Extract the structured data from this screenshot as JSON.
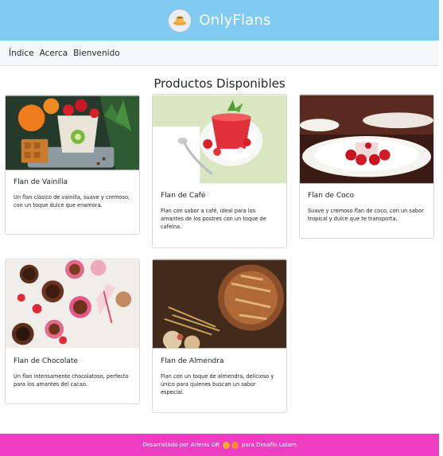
{
  "app": {
    "brand": "OnlyFlans",
    "logo_text": "FLAN"
  },
  "nav": {
    "items": [
      "Índice",
      "Acerca",
      "Bienvenido"
    ]
  },
  "main": {
    "title": "Productos Disponibles",
    "products": [
      {
        "name": "Flan de Vainilla",
        "description": "Un flan clásico de vainilla, suave y cremoso, con un toque dulce que enamora."
      },
      {
        "name": "Flan de Café",
        "description": "Flan con sabor a café, ideal para los amantes de los postres con un toque de cafeína."
      },
      {
        "name": "Flan de Coco",
        "description": "Suave y cremoso flan de coco, con un sabor tropical y dulce que te transporta."
      },
      {
        "name": "Flan de Chocolate",
        "description": "Un flan intensamente chocolatoso, perfecto para los amantes del cacao."
      },
      {
        "name": "Flan de Almendra",
        "description": "Flan con un toque de almendra, delicioso y único para quienes buscan un sabor especial."
      }
    ]
  },
  "footer": {
    "text_before": "Desarrollado por Arlenis GR",
    "text_after": "para Desafío Latam"
  }
}
